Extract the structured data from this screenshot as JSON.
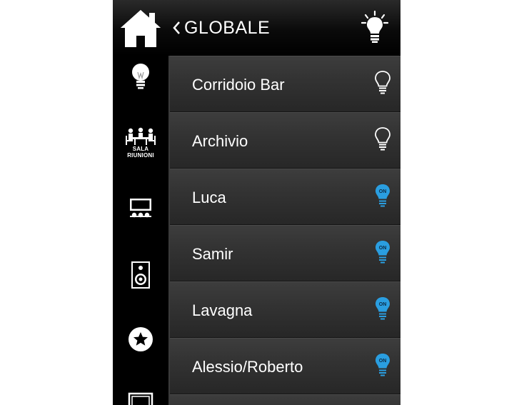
{
  "header": {
    "back_label": "GLOBALE",
    "home_icon": "home-icon",
    "lighting_icon": "lightbulb-icon"
  },
  "sidebar": {
    "items": [
      {
        "name": "lighting",
        "icon": "lightbulb-icon",
        "label": ""
      },
      {
        "name": "sala-riunioni",
        "icon": "meeting-room-icon",
        "label_line1": "SALA",
        "label_line2": "RIUNIONI"
      },
      {
        "name": "av",
        "icon": "monitor-icon",
        "label": ""
      },
      {
        "name": "audio",
        "icon": "speaker-icon",
        "label": ""
      },
      {
        "name": "favorites",
        "icon": "star-icon",
        "label": ""
      },
      {
        "name": "more",
        "icon": "frame-icon",
        "label": ""
      }
    ]
  },
  "lights": [
    {
      "label": "Corridoio Bar",
      "state": "off"
    },
    {
      "label": "Archivio",
      "state": "off"
    },
    {
      "label": "Luca",
      "state": "on",
      "badge": "ON"
    },
    {
      "label": "Samir",
      "state": "on",
      "badge": "ON"
    },
    {
      "label": "Lavagna",
      "state": "on",
      "badge": "ON"
    },
    {
      "label": "Alessio/Roberto",
      "state": "on",
      "badge": "ON"
    }
  ],
  "colors": {
    "on_accent": "#2a9ee0",
    "row_bg": "#333333",
    "sidebar_bg": "#000000"
  }
}
